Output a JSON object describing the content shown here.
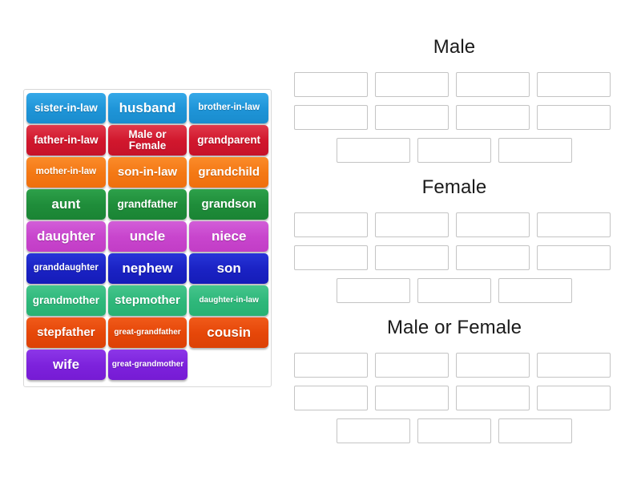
{
  "source_panel": {
    "name": "word-tile-bank",
    "rows": [
      {
        "color": "#1f95d8",
        "color_class": "c-skyblue",
        "tiles": [
          {
            "label": "sister-in-law",
            "size": "fs-md"
          },
          {
            "label": "husband",
            "size": "fs-xl"
          },
          {
            "label": "brother-in-law",
            "size": "fs-sm"
          }
        ]
      },
      {
        "color": "#d1172d",
        "color_class": "c-crimson",
        "tiles": [
          {
            "label": "father-in-law",
            "size": "fs-md"
          },
          {
            "label": "Male or\nFemale",
            "size": "fs-md"
          },
          {
            "label": "grandparent",
            "size": "fs-md"
          }
        ]
      },
      {
        "color": "#f47915",
        "color_class": "c-orange",
        "tiles": [
          {
            "label": "mother-in-law",
            "size": "fs-sm"
          },
          {
            "label": "son-in-law",
            "size": "fs-lg"
          },
          {
            "label": "grandchild",
            "size": "fs-lg"
          }
        ]
      },
      {
        "color": "#1f8d3a",
        "color_class": "c-green",
        "tiles": [
          {
            "label": "aunt",
            "size": "fs-xl"
          },
          {
            "label": "grandfather",
            "size": "fs-md"
          },
          {
            "label": "grandson",
            "size": "fs-lg"
          }
        ]
      },
      {
        "color": "#c845cd",
        "color_class": "c-magenta",
        "tiles": [
          {
            "label": "daughter",
            "size": "fs-xl"
          },
          {
            "label": "uncle",
            "size": "fs-xl"
          },
          {
            "label": "niece",
            "size": "fs-xl"
          }
        ]
      },
      {
        "color": "#1a22c4",
        "color_class": "c-blue",
        "tiles": [
          {
            "label": "granddaughter",
            "size": "fs-sm"
          },
          {
            "label": "nephew",
            "size": "fs-xl"
          },
          {
            "label": "son",
            "size": "fs-xl"
          }
        ]
      },
      {
        "color": "#2fb87b",
        "color_class": "c-emerald",
        "tiles": [
          {
            "label": "grandmother",
            "size": "fs-md"
          },
          {
            "label": "stepmother",
            "size": "fs-lg"
          },
          {
            "label": "daughter-in-law",
            "size": "fs-xs"
          }
        ]
      },
      {
        "color": "#e64709",
        "color_class": "c-orangered",
        "tiles": [
          {
            "label": "stepfather",
            "size": "fs-lg"
          },
          {
            "label": "great-grandfather",
            "size": "fs-xs"
          },
          {
            "label": "cousin",
            "size": "fs-xl"
          }
        ]
      },
      {
        "color": "#7d22dc",
        "color_class": "c-purple",
        "tiles": [
          {
            "label": "wife",
            "size": "fs-xl"
          },
          {
            "label": "great-grandmother",
            "size": "fs-xs"
          }
        ]
      }
    ]
  },
  "groups": [
    {
      "title": "Male",
      "rows": [
        {
          "slots": 4,
          "centered": false
        },
        {
          "slots": 4,
          "centered": false
        },
        {
          "slots": 3,
          "centered": true
        }
      ]
    },
    {
      "title": "Female",
      "rows": [
        {
          "slots": 4,
          "centered": false
        },
        {
          "slots": 4,
          "centered": false
        },
        {
          "slots": 3,
          "centered": true
        }
      ]
    },
    {
      "title": "Male or Female",
      "rows": [
        {
          "slots": 4,
          "centered": false
        },
        {
          "slots": 4,
          "centered": false
        },
        {
          "slots": 3,
          "centered": true
        }
      ]
    }
  ]
}
